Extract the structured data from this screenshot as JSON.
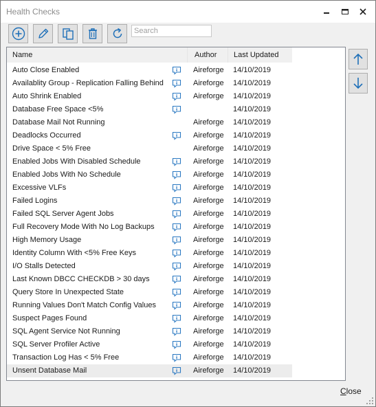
{
  "window": {
    "title": "Health Checks"
  },
  "toolbar": {
    "buttons": [
      {
        "icon": "add-icon"
      },
      {
        "icon": "edit-icon"
      },
      {
        "icon": "copy-icon"
      },
      {
        "icon": "delete-icon"
      },
      {
        "icon": "refresh-icon"
      }
    ],
    "search_placeholder": "Search"
  },
  "table": {
    "columns": {
      "name": "Name",
      "author": "Author",
      "last_updated": "Last Updated"
    },
    "rows": [
      {
        "name": "Auto Close Enabled",
        "note": true,
        "author": "Aireforge",
        "date": "14/10/2019"
      },
      {
        "name": "Availablity Group - Replication Falling Behind",
        "note": true,
        "author": "Aireforge",
        "date": "14/10/2019"
      },
      {
        "name": "Auto Shrink Enabled",
        "note": true,
        "author": "Aireforge",
        "date": "14/10/2019"
      },
      {
        "name": "Database Free Space <5%",
        "note": true,
        "author": "",
        "date": "14/10/2019"
      },
      {
        "name": "Database Mail Not Running",
        "note": false,
        "author": "Aireforge",
        "date": "14/10/2019"
      },
      {
        "name": "Deadlocks Occurred",
        "note": true,
        "author": "Aireforge",
        "date": "14/10/2019"
      },
      {
        "name": "Drive Space < 5% Free",
        "note": false,
        "author": "Aireforge",
        "date": "14/10/2019"
      },
      {
        "name": "Enabled Jobs With Disabled Schedule",
        "note": true,
        "author": "Aireforge",
        "date": "14/10/2019"
      },
      {
        "name": "Enabled Jobs With No Schedule",
        "note": true,
        "author": "Aireforge",
        "date": "14/10/2019"
      },
      {
        "name": "Excessive VLFs",
        "note": true,
        "author": "Aireforge",
        "date": "14/10/2019"
      },
      {
        "name": "Failed Logins",
        "note": true,
        "author": "Aireforge",
        "date": "14/10/2019"
      },
      {
        "name": "Failed SQL Server Agent Jobs",
        "note": true,
        "author": "Aireforge",
        "date": "14/10/2019"
      },
      {
        "name": "Full Recovery Mode With No Log Backups",
        "note": true,
        "author": "Aireforge",
        "date": "14/10/2019"
      },
      {
        "name": "High Memory Usage",
        "note": true,
        "author": "Aireforge",
        "date": "14/10/2019"
      },
      {
        "name": "Identity Column With <5% Free Keys",
        "note": true,
        "author": "Aireforge",
        "date": "14/10/2019"
      },
      {
        "name": "I/O Stalls Detected",
        "note": true,
        "author": "Aireforge",
        "date": "14/10/2019"
      },
      {
        "name": "Last Known DBCC CHECKDB > 30 days",
        "note": true,
        "author": "Aireforge",
        "date": "14/10/2019"
      },
      {
        "name": "Query Store In Unexpected State",
        "note": true,
        "author": "Aireforge",
        "date": "14/10/2019"
      },
      {
        "name": "Running Values Don't Match Config Values",
        "note": true,
        "author": "Aireforge",
        "date": "14/10/2019"
      },
      {
        "name": "Suspect Pages Found",
        "note": true,
        "author": "Aireforge",
        "date": "14/10/2019"
      },
      {
        "name": "SQL Agent Service Not Running",
        "note": true,
        "author": "Aireforge",
        "date": "14/10/2019"
      },
      {
        "name": "SQL Server Profiler Active",
        "note": true,
        "author": "Aireforge",
        "date": "14/10/2019"
      },
      {
        "name": "Transaction Log Has < 5% Free",
        "note": true,
        "author": "Aireforge",
        "date": "14/10/2019"
      },
      {
        "name": "Unsent Database Mail",
        "note": true,
        "author": "Aireforge",
        "date": "14/10/2019",
        "selected": true
      }
    ]
  },
  "side": {
    "move_up_icon": "arrow-up-icon",
    "move_down_icon": "arrow-down-icon"
  },
  "footer": {
    "close_first": "C",
    "close_rest": "lose"
  },
  "colors": {
    "accent": "#1e6fb8",
    "note_icon": "#2b79c2"
  }
}
